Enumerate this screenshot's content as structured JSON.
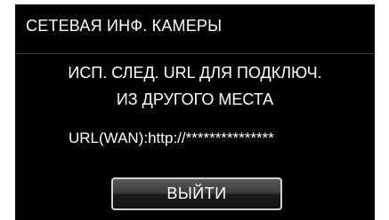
{
  "header": {
    "title": "СЕТЕВАЯ ИНФ. КАМЕРЫ"
  },
  "message": {
    "line1": "ИСП. СЛЕД. URL ДЛЯ ПОДКЛЮЧ.",
    "line2": "ИЗ ДРУГОГО МЕСТА"
  },
  "url": {
    "text": "URL(WAN):http://***************"
  },
  "buttons": {
    "exit_label": "ВЫЙТИ"
  }
}
